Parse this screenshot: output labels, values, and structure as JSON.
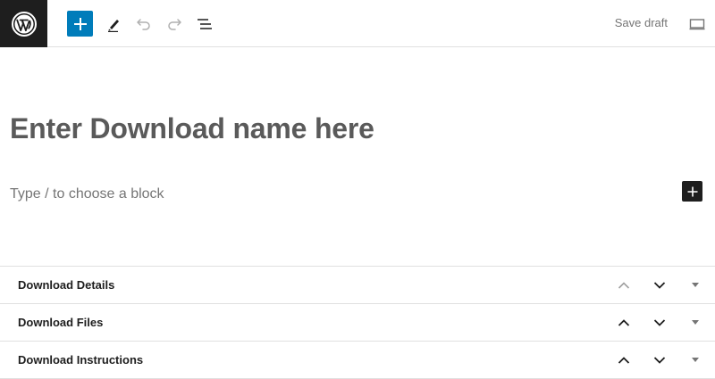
{
  "toolbar": {
    "save_draft_label": "Save draft"
  },
  "editor": {
    "title_placeholder": "Enter Download name here",
    "block_placeholder": "Type / to choose a block"
  },
  "metaboxes": [
    {
      "title": "Download Details",
      "move_up_disabled": true
    },
    {
      "title": "Download Files",
      "move_up_disabled": false
    },
    {
      "title": "Download Instructions",
      "move_up_disabled": false
    }
  ],
  "colors": {
    "accent": "#007cba",
    "dark": "#1e1e1e",
    "muted": "#757575"
  },
  "icons": {
    "logo": "wordpress-logo-icon",
    "inserter": "plus-icon",
    "tools": "pencil-icon",
    "undo": "undo-icon",
    "redo": "redo-icon",
    "outline": "list-view-icon",
    "preview": "desktop-preview-icon",
    "move_up": "chevron-up-icon",
    "move_down": "chevron-down-icon",
    "toggle": "caret-down-icon"
  }
}
